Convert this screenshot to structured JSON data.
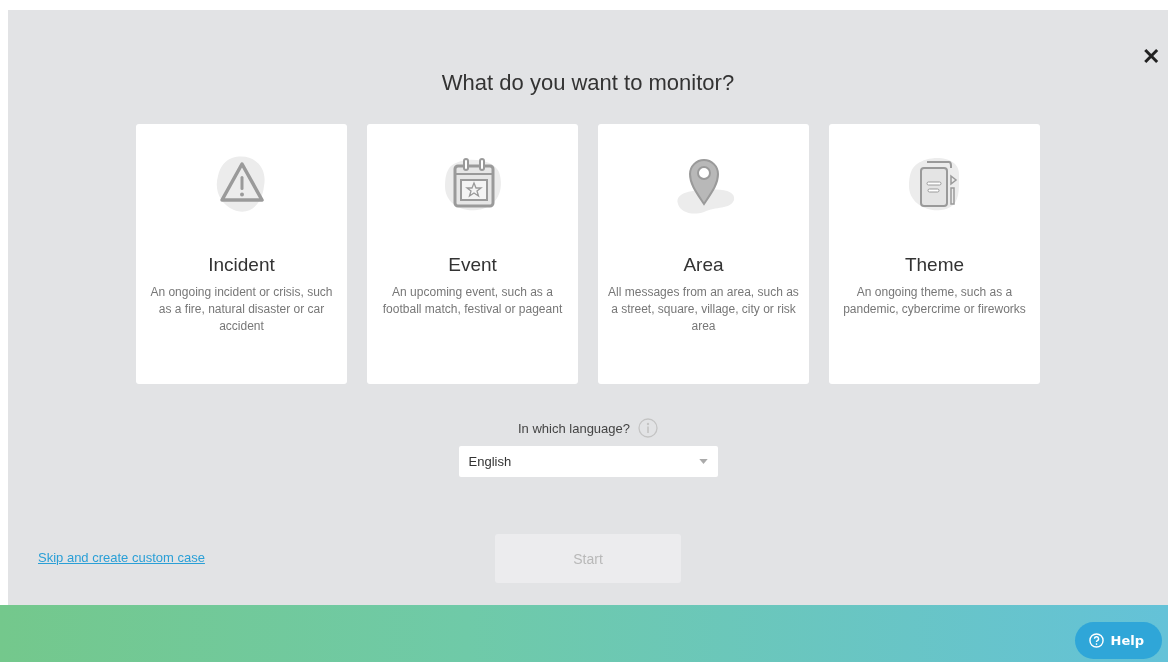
{
  "close_button": {
    "label": "✕"
  },
  "title": "What do you want to monitor?",
  "cards": [
    {
      "kind": "alert",
      "title": "Incident",
      "description": "An ongoing incident or crisis, such as a fire, natural disaster or car accident"
    },
    {
      "kind": "calendar",
      "title": "Event",
      "description": "An upcoming event, such as a football match, festival or pageant"
    },
    {
      "kind": "pin",
      "title": "Area",
      "description": "All messages from an area, such as a street, square, village, city or risk area"
    },
    {
      "kind": "document",
      "title": "Theme",
      "description": "An ongoing theme, such as a pandemic, cybercrime or fireworks"
    }
  ],
  "language": {
    "label": "In which language?",
    "value": "English"
  },
  "skip_link": "Skip and create custom case",
  "start_button": {
    "label": "Start",
    "disabled": true
  },
  "help_button": {
    "label": "Help"
  }
}
